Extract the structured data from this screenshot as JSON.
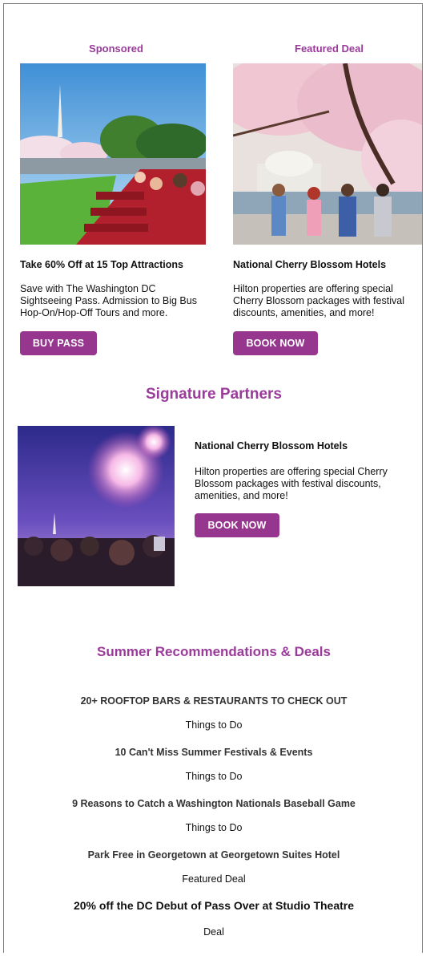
{
  "cards": [
    {
      "eyebrow": "Sponsored",
      "photo": "photo-washington-monument-tour-bus",
      "title": "Take 60% Off at 15 Top Attractions",
      "text": "Save with The Washington DC Sightseeing Pass. Admission to Big Bus Hop-On/Hop-Off Tours and more.",
      "button": "BUY PASS"
    },
    {
      "eyebrow": "Featured Deal",
      "photo": "photo-cherry-blossom-friends",
      "title": "National Cherry Blossom Hotels",
      "text": "Hilton properties are offering special Cherry Blossom packages with festival discounts, amenities, and more!",
      "button": "BOOK NOW"
    }
  ],
  "signature": {
    "title": "Signature Partners",
    "photo": "photo-fireworks-crowd",
    "name": "National Cherry Blossom Hotels",
    "text": "Hilton properties are offering special Cherry Blossom packages with festival discounts, amenities, and more!",
    "button": "BOOK NOW"
  },
  "summer": {
    "title": "Summer Recommendations & Deals",
    "items": [
      {
        "headline": "20+ ROOFTOP BARS & RESTAURANTS TO CHECK OUT",
        "category": "Things to Do"
      },
      {
        "headline": "10 Can't Miss Summer Festivals & Events",
        "category": "Things to Do"
      },
      {
        "headline": "9 Reasons to Catch a Washington Nationals Baseball Game",
        "category": "Things to Do"
      },
      {
        "headline": "Park Free in Georgetown at Georgetown Suites Hotel",
        "category": "Featured Deal"
      },
      {
        "headline": "20% off the DC Debut of Pass Over at Studio Theatre",
        "category": "Deal"
      }
    ]
  },
  "colors": {
    "accent": "#96368e",
    "heading": "#9a3a9a"
  }
}
